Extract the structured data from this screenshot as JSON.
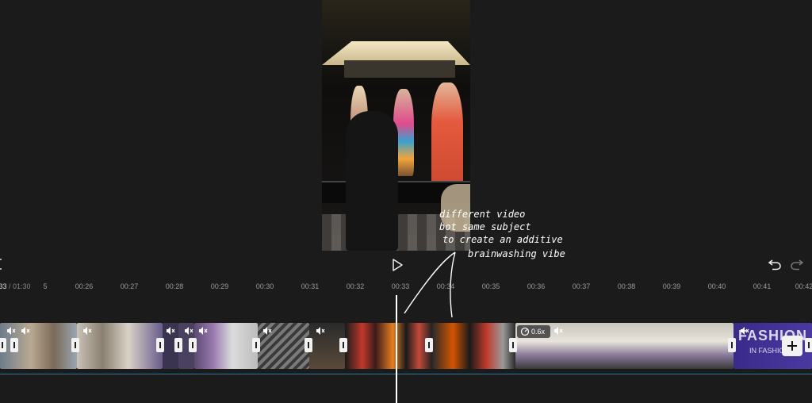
{
  "preview": {
    "annotation_lines": [
      "different video",
      "bot same subject",
      "to create an additive",
      "brainwashing vibe"
    ]
  },
  "controls": {
    "current_time": ":33",
    "total_time": "/ 01:30",
    "play_icon": "play-icon",
    "undo_icon": "undo-icon",
    "redo_icon": "redo-icon"
  },
  "ruler": {
    "first_partial": "5",
    "ticks": [
      "00:26",
      "00:27",
      "00:28",
      "00:29",
      "00:30",
      "00:31",
      "00:32",
      "00:33",
      "00:34",
      "00:35",
      "00:36",
      "00:37",
      "00:38",
      "00:39",
      "00:40",
      "00:41",
      "00:42"
    ]
  },
  "timeline": {
    "speed_label": "0.6x",
    "last_clip_text": "FASHION",
    "last_clip_sub": "IN FASHION",
    "add_icon": "plus-icon"
  },
  "colors": {
    "background": "#1b1b1c",
    "playhead": "#ffffff",
    "track_line": "#2a7aa0"
  }
}
